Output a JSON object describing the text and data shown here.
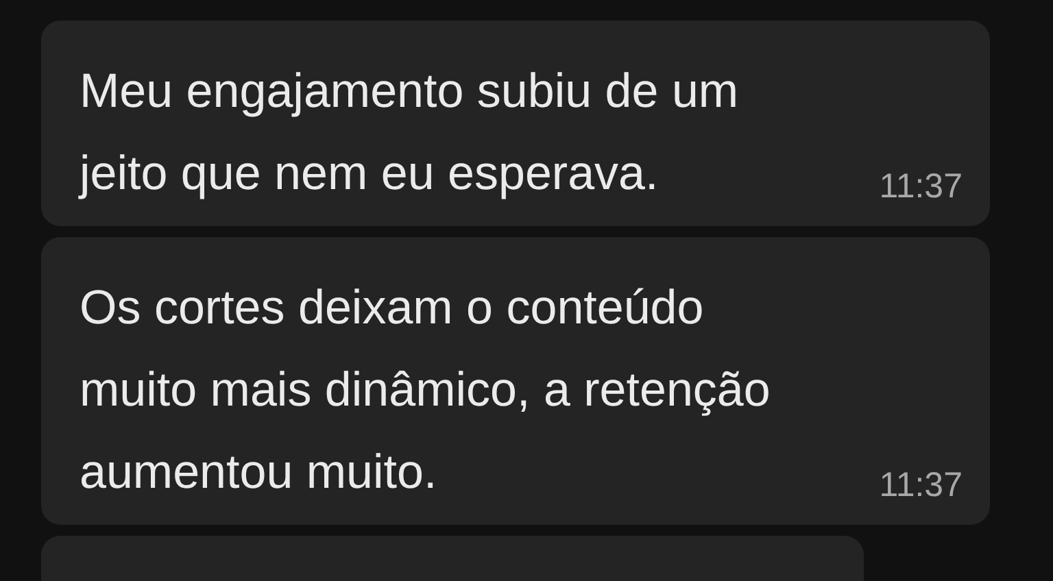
{
  "messages": [
    {
      "kind": "message",
      "lines": [
        "Meu engajamento subiu de um",
        "jeito que nem eu esperava."
      ],
      "time": "11:37"
    },
    {
      "kind": "message",
      "lines": [
        "Os cortes deixam o conteúdo",
        "muito mais dinâmico, a retenção",
        "aumentou muito."
      ],
      "time": "11:37"
    },
    {
      "kind": "cut_off"
    }
  ]
}
